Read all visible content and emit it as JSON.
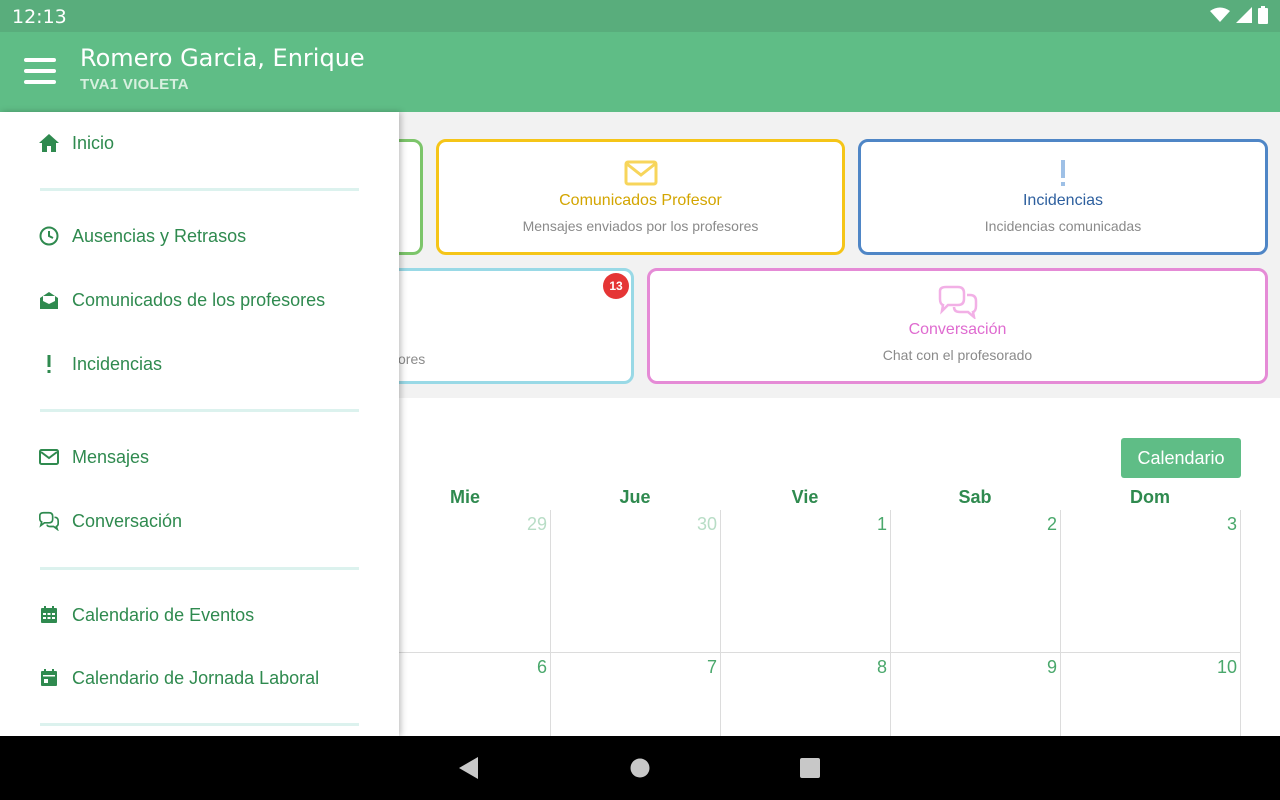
{
  "status_bar": {
    "time": "12:13",
    "icons": [
      "wifi-icon",
      "signal-icon",
      "battery-icon"
    ]
  },
  "app_bar": {
    "title": "Romero Garcia, Enrique",
    "subtitle": "TVA1 VIOLETA",
    "menu_icon": "hamburger-icon"
  },
  "cards": [
    {
      "title": "Comunicados Profesor",
      "subtitle": "Mensajes enviados por los profesores",
      "icon": "envelope-icon",
      "color": "#f5c518"
    },
    {
      "title": "Incidencias",
      "subtitle": "Incidencias comunicadas",
      "icon": "exclamation-icon",
      "color": "#4f86c6"
    },
    {
      "title": "",
      "subtitle": "ores",
      "badge": "13",
      "color": "#99d9e6"
    },
    {
      "title": "Conversación",
      "subtitle": "Chat con el profesorado",
      "icon": "chat-icon",
      "color": "#e58bd6"
    }
  ],
  "calendar": {
    "button_label": "Calendario",
    "day_headers": [
      "Mie",
      "Jue",
      "Vie",
      "Sab",
      "Dom"
    ],
    "week1": [
      "29",
      "30",
      "1",
      "2",
      "3"
    ],
    "week2": [
      "6",
      "7",
      "8",
      "9",
      "10"
    ]
  },
  "drawer": {
    "items": [
      {
        "label": "Inicio",
        "icon": "home-icon"
      },
      {
        "label": "Ausencias y Retrasos",
        "icon": "clock-icon"
      },
      {
        "label": "Comunicados de los profesores",
        "icon": "open-envelope-icon"
      },
      {
        "label": "Incidencias",
        "icon": "exclamation-icon"
      },
      {
        "label": "Mensajes",
        "icon": "envelope-icon"
      },
      {
        "label": "Conversación",
        "icon": "chat-icon"
      },
      {
        "label": "Calendario de Eventos",
        "icon": "calendar-grid-icon"
      },
      {
        "label": "Calendario de Jornada Laboral",
        "icon": "calendar-icon"
      }
    ]
  },
  "colors": {
    "primary": "#5fbd86",
    "status_bar": "#59ad7c",
    "text_green": "#2f8a4f",
    "badge": "#e53535"
  },
  "nav_bar": {
    "icons": [
      "back-icon",
      "home-circle-icon",
      "recents-icon"
    ]
  }
}
